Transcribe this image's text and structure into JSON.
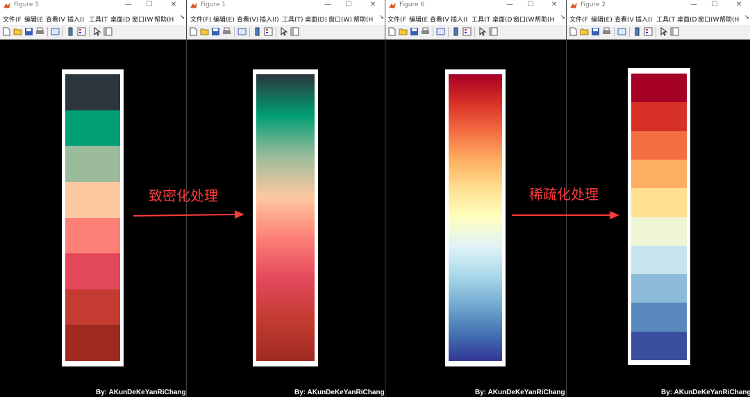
{
  "windows": [
    {
      "title": "Figure 5",
      "menus": [
        "文件(F",
        "编辑(E",
        "查看(V",
        "插入(I",
        "工具(T",
        "桌面(D",
        "窗口(W",
        "帮助(H"
      ]
    },
    {
      "title": "Figure 1",
      "menus": [
        "文件(F)",
        "编辑(E)",
        "查看(V)",
        "插入(I)",
        "工具(T)",
        "桌面(D)",
        "窗口(W)",
        "帮助(H"
      ]
    },
    {
      "title": "Figure 6",
      "menus": [
        "文件(F",
        "编辑(E",
        "查看(V",
        "插入(I",
        "工具(T",
        "桌面(D",
        "窗口(W",
        "帮助(H"
      ]
    },
    {
      "title": "Figure 2",
      "menus": [
        "文件(F",
        "编辑(E)",
        "查看(V",
        "插入(I",
        "工具(T",
        "桌面(D",
        "窗口(W",
        "帮助(H"
      ]
    }
  ],
  "annotations": {
    "densify": "致密化处理",
    "sparsify": "稀疏化处理",
    "credit": "By: AKunDeKeYanRiChang"
  },
  "colormaps": {
    "figure5": [
      "#2c363d",
      "#009e73",
      "#9bbb9b",
      "#fdc9a0",
      "#fd8077",
      "#e3485a",
      "#c33b31",
      "#9e2a20"
    ],
    "figure1": [
      "#2c363d",
      "#009e73",
      "#9bbb9b",
      "#fdc9a0",
      "#fd8077",
      "#e3485a",
      "#c33b31",
      "#9e2a20"
    ],
    "figure6": [
      "#a50026",
      "#d73027",
      "#f46d43",
      "#fdae61",
      "#fee090",
      "#ffffbf",
      "#e0f3f8",
      "#abd9e9",
      "#74add1",
      "#4575b4",
      "#313695"
    ],
    "figure2": [
      "#a50026",
      "#d73027",
      "#f46d43",
      "#fdae61",
      "#fee090",
      "#eef6d5",
      "#c6e3ef",
      "#8bbbd9",
      "#5989bd",
      "#3a4e9e"
    ]
  },
  "colors": {
    "annotation_red": "#ff3b3b"
  },
  "icons": [
    "matlab-icon",
    "new-file-icon",
    "open-folder-icon",
    "save-icon",
    "print-icon",
    "zoom-icon",
    "insert-colorbar-icon",
    "insert-legend-icon",
    "pointer-icon",
    "property-inspector-icon"
  ]
}
